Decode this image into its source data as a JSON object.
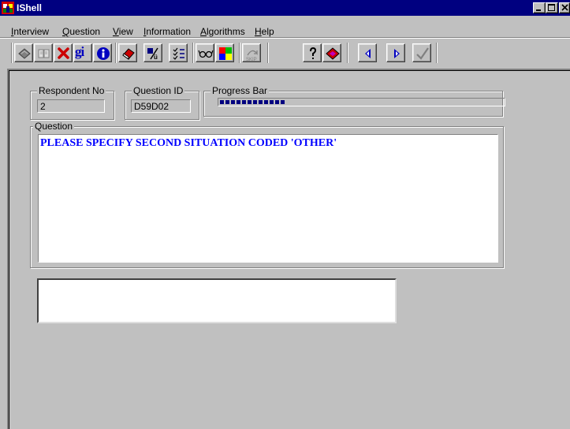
{
  "window": {
    "title": "IShell",
    "controls": [
      "minimize-icon",
      "maximize-icon",
      "close-icon"
    ]
  },
  "menu": {
    "items": [
      {
        "label": "Interview",
        "mnemonic": "I"
      },
      {
        "label": "Question",
        "mnemonic": "Q"
      },
      {
        "label": "View",
        "mnemonic": "V"
      },
      {
        "label": "Information",
        "mnemonic": "I"
      },
      {
        "label": "Algorithms",
        "mnemonic": "A"
      },
      {
        "label": "Help",
        "mnemonic": "H"
      }
    ]
  },
  "toolbar": {
    "gi_label": "gi",
    "buttons": [
      "book-icon",
      "open-book-icon",
      "delete-x-icon",
      "gi-icon",
      "info-icon",
      "eraser-icon",
      "format-icon",
      "checklist-icon",
      "glasses-icon",
      "color-squares-icon",
      "skip-icon",
      "help-question-icon",
      "notebook-icon",
      "previous-arrow-icon",
      "next-arrow-icon",
      "check-icon"
    ]
  },
  "respondent": {
    "label": "Respondent No",
    "value": "2"
  },
  "question_id": {
    "label": "Question ID",
    "value": "D59D02"
  },
  "progress": {
    "label": "Progress Bar",
    "fraction": 0.23
  },
  "question": {
    "label": "Question",
    "text": "PLEASE SPECIFY SECOND SITUATION CODED 'OTHER'"
  },
  "answer": {
    "value": ""
  },
  "colors": {
    "title_bar": "#000080",
    "question_text": "#0000ff",
    "window_bg": "#c0c0c0",
    "progress": "#000080"
  }
}
